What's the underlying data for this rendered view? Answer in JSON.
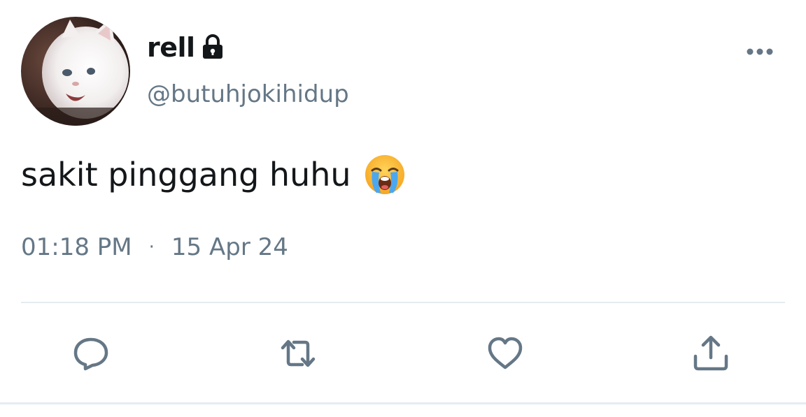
{
  "author": {
    "display_name": "rell",
    "handle": "@butuhjokihidup",
    "protected": true,
    "avatar": "white-kitten-photo"
  },
  "tweet": {
    "text": "sakit pinggang huhu",
    "emoji": "loudly-crying-face",
    "time": "01:18 PM",
    "separator": "·",
    "date": "15 Apr 24"
  },
  "actions": {
    "reply_icon": "reply-icon",
    "retweet_icon": "retweet-icon",
    "like_icon": "like-icon",
    "share_icon": "share-icon"
  },
  "colors": {
    "text_primary": "#14171a",
    "text_secondary": "#657786",
    "icon": "#657786",
    "divider": "#e6ecf0"
  }
}
